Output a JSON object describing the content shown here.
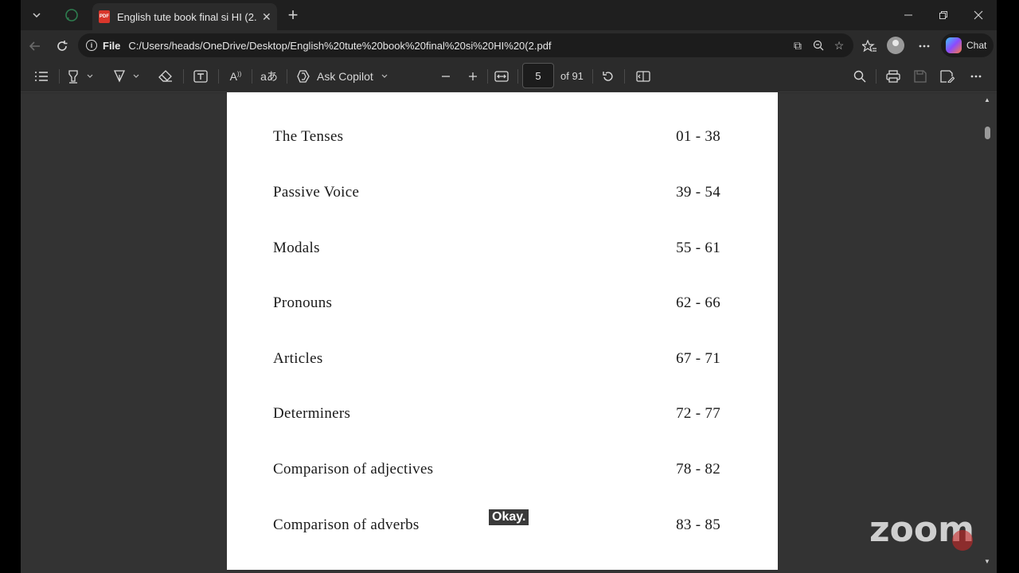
{
  "tab": {
    "title": "English tute book final si HI (2.pdf",
    "close": "✕",
    "new_tab": "+"
  },
  "address": {
    "scheme_label": "File",
    "url": "C:/Users/heads/OneDrive/Desktop/English%20tute%20book%20final%20si%20HI%20(2.pdf"
  },
  "chat_button": {
    "label": "Chat"
  },
  "pdf_toolbar": {
    "ask_copilot_label": "Ask Copilot",
    "current_page": "5",
    "page_total": "of 91"
  },
  "toc": [
    {
      "title": "The Tenses",
      "pages": "01 - 38"
    },
    {
      "title": "Passive Voice",
      "pages": "39 - 54"
    },
    {
      "title": "Modals",
      "pages": "55 - 61"
    },
    {
      "title": "Pronouns",
      "pages": "62 - 66"
    },
    {
      "title": "Articles",
      "pages": "67 - 71"
    },
    {
      "title": "Determiners",
      "pages": "72 - 77"
    },
    {
      "title": "Comparison of adjectives",
      "pages": "78 - 82"
    },
    {
      "title": "Comparison of adverbs",
      "pages": "83 - 85"
    }
  ],
  "caption": "Okay.",
  "zoom_logo": "zoom",
  "icons": {
    "tab_actions": "chevron-down-icon",
    "whatsapp": "whatsapp-icon",
    "pdf": "pdf-icon"
  },
  "colors": {
    "pdf_badge": "#d9362b",
    "page_bg": "#ffffff",
    "viewer_bg": "#333333"
  }
}
